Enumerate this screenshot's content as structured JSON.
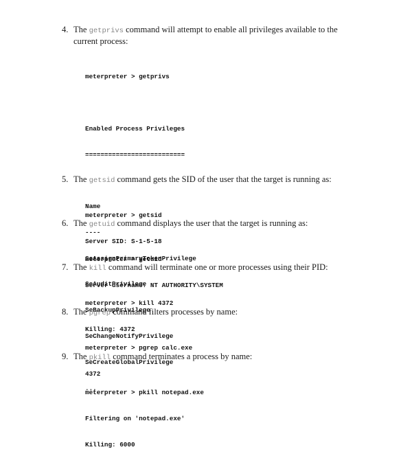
{
  "items": [
    {
      "number": "4.",
      "before": "The ",
      "command": "getprivs",
      "after": " command will attempt to enable all privileges available to the current process:",
      "code": [
        "meterpreter > getprivs",
        "",
        "Enabled Process Privileges",
        "==========================",
        "",
        "Name",
        "----",
        "SeAssignPrimaryTokenPrivilege",
        "SeAuditPrivilege",
        "SeBackupPrivilege",
        "SeChangeNotifyPrivilege",
        "SeCreateGlobalPrivilege",
        "..."
      ]
    },
    {
      "number": "5.",
      "before": "The ",
      "command": "getsid",
      "after": " command gets the SID of the user that the target is running as:",
      "code": [
        "meterpreter > getsid",
        "Server SID: S-1-5-18"
      ]
    },
    {
      "number": "6.",
      "before": "The ",
      "command": "getuid",
      "after": " command displays the user that the target is running as:",
      "code": [
        "meterpreter > getuid",
        "Server username: NT AUTHORITY\\SYSTEM"
      ]
    },
    {
      "number": "7.",
      "before": "The ",
      "command": "kill",
      "after": " command will terminate one or more processes using their PID:",
      "code": [
        "meterpreter > kill 4372",
        "Killing: 4372"
      ]
    },
    {
      "number": "8.",
      "before": "The ",
      "command": "pgrep",
      "after": " command filters processes by name:",
      "code": [
        "meterpreter > pgrep calc.exe",
        "4372"
      ]
    },
    {
      "number": "9.",
      "before": "The ",
      "command": "pkill",
      "after": " command terminates a process by name:",
      "code": [
        "meterpreter > pkill notepad.exe",
        "Filtering on 'notepad.exe'",
        "Killing: 6000"
      ]
    }
  ]
}
